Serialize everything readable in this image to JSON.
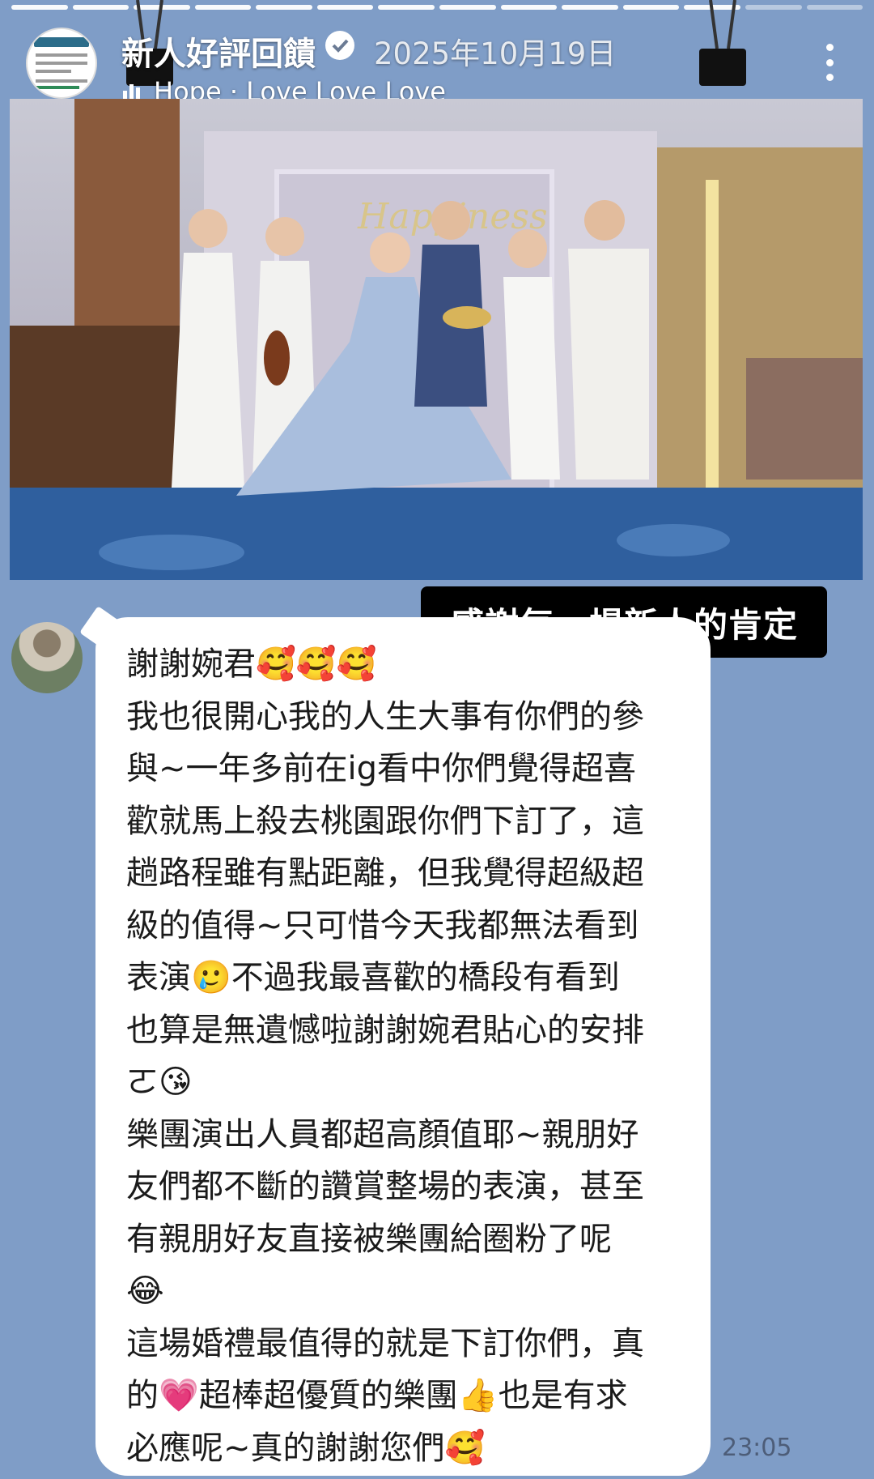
{
  "story": {
    "segments_total": 14,
    "segments_done": 12,
    "account_name": "新人好評回饋",
    "verified": true,
    "date": "2025年10月19日",
    "music": "Hope · Love Love Love",
    "more_icon": "more-vertical-icon"
  },
  "photo": {
    "sign_text": "Happiness",
    "alt": "wedding group photo"
  },
  "caption": "感謝每一場新人的肯定",
  "message": {
    "lines": [
      "謝謝婉君🥰🥰🥰",
      "我也很開心我的人生大事有你們的參",
      "與~一年多前在ig看中你們覺得超喜",
      "歡就馬上殺去桃園跟你們下訂了，這",
      "趟路程雖有點距離，但我覺得超級超",
      "級的值得~只可惜今天我都無法看到",
      "表演🥲不過我最喜歡的橋段有看到",
      "也算是無遺憾啦謝謝婉君貼心的安排",
      "ㄛ😘",
      "樂團演出人員都超高顏值耶~親朋好",
      "友們都不斷的讚賞整場的表演，甚至",
      "有親朋好友直接被樂團給圈粉了呢",
      "😂",
      "這場婚禮最值得的就是下訂你們，真",
      "的💗超棒超優質的樂團👍也是有求",
      "必應呢~真的謝謝您們🥰"
    ],
    "time": "23:05"
  },
  "colors": {
    "chat_bg": "#7f9dc7",
    "bubble": "#ffffff",
    "caption_bg": "#000000"
  }
}
